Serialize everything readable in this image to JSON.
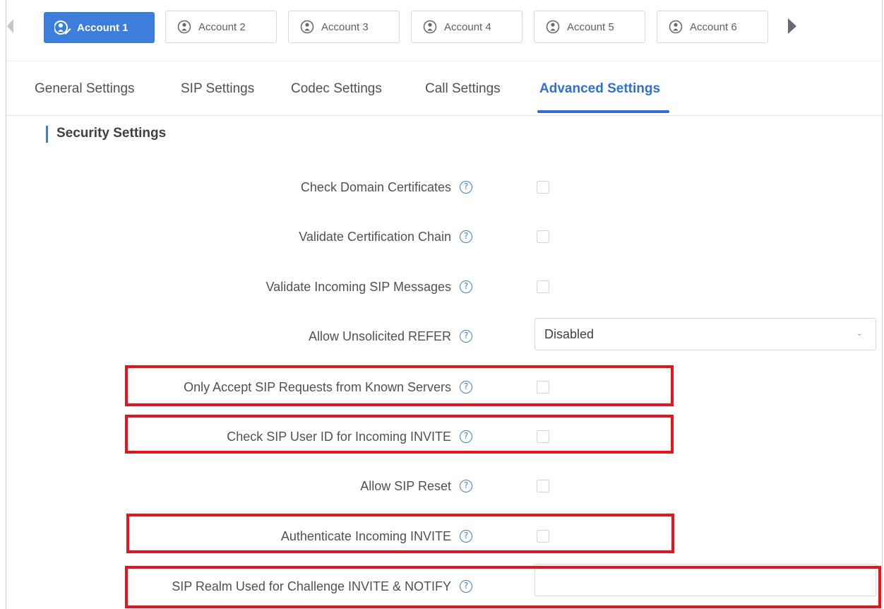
{
  "accounts": {
    "tabs": [
      {
        "label": "Account 1",
        "active": true
      },
      {
        "label": "Account 2",
        "active": false
      },
      {
        "label": "Account 3",
        "active": false
      },
      {
        "label": "Account 4",
        "active": false
      },
      {
        "label": "Account 5",
        "active": false
      },
      {
        "label": "Account 6",
        "active": false
      }
    ]
  },
  "subtabs": [
    {
      "label": "General Settings",
      "active": false
    },
    {
      "label": "SIP Settings",
      "active": false
    },
    {
      "label": "Codec Settings",
      "active": false
    },
    {
      "label": "Call Settings",
      "active": false
    },
    {
      "label": "Advanced Settings",
      "active": true
    }
  ],
  "section": {
    "title": "Security Settings"
  },
  "fields": [
    {
      "label": "Check Domain Certificates",
      "type": "checkbox",
      "checked": false
    },
    {
      "label": "Validate Certification Chain",
      "type": "checkbox",
      "checked": false
    },
    {
      "label": "Validate Incoming SIP Messages",
      "type": "checkbox",
      "checked": false
    },
    {
      "label": "Allow Unsolicited REFER",
      "type": "select",
      "value": "Disabled"
    },
    {
      "label": "Only Accept SIP Requests from Known Servers",
      "type": "checkbox",
      "checked": false,
      "highlighted": true
    },
    {
      "label": "Check SIP User ID for Incoming INVITE",
      "type": "checkbox",
      "checked": false,
      "highlighted": true
    },
    {
      "label": "Allow SIP Reset",
      "type": "checkbox",
      "checked": false
    },
    {
      "label": "Authenticate Incoming INVITE",
      "type": "checkbox",
      "checked": false,
      "highlighted": true
    },
    {
      "label": "SIP Realm Used for Challenge INVITE & NOTIFY",
      "type": "text",
      "value": "",
      "highlighted": true
    }
  ],
  "colors": {
    "accent": "#3d7ddc",
    "highlight": "#e8141c"
  },
  "icons": {
    "account": "user-icon",
    "help": "question-circle-icon",
    "select": "chevron-down-icon"
  }
}
